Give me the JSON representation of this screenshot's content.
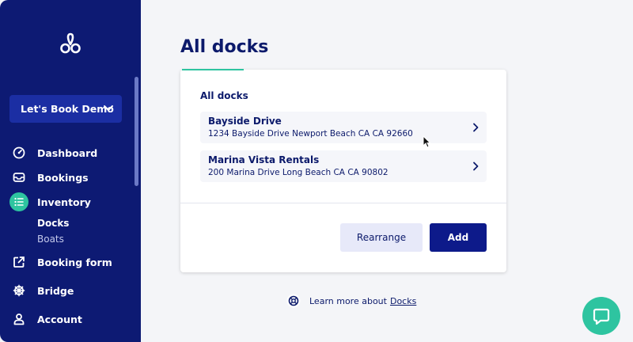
{
  "sidebar": {
    "org_name": "Let's Book Demo",
    "nav": {
      "dashboard": "Dashboard",
      "bookings": "Bookings",
      "inventory": "Inventory",
      "docks": "Docks",
      "boats": "Boats",
      "booking_form": "Booking form",
      "bridge": "Bridge",
      "account": "Account"
    }
  },
  "main": {
    "title": "All docks",
    "section_title": "All docks",
    "docks": [
      {
        "name": "Bayside Drive",
        "address": "1234 Bayside Drive Newport Beach CA CA 92660"
      },
      {
        "name": "Marina Vista Rentals",
        "address": "200 Marina Drive Long Beach CA CA 90802"
      }
    ],
    "buttons": {
      "rearrange": "Rearrange",
      "add": "Add"
    },
    "learn_more": {
      "text": "Learn more about",
      "link": "Docks"
    }
  },
  "colors": {
    "sidebar_bg": "#0d1a73",
    "accent_green": "#2ec4a0",
    "primary_button": "#0d1a8a",
    "text_navy": "#0c1a6b"
  },
  "icons": {
    "logo": "brand-logo-icon",
    "dashboard": "speedometer-icon",
    "bookings": "inbox-icon",
    "inventory": "list-icon",
    "booking_form": "external-link-icon",
    "bridge": "ship-wheel-icon",
    "account": "user-icon",
    "dock_row": "chevron-right-icon",
    "learn_more": "lifebuoy-icon",
    "help": "chat-icon"
  }
}
